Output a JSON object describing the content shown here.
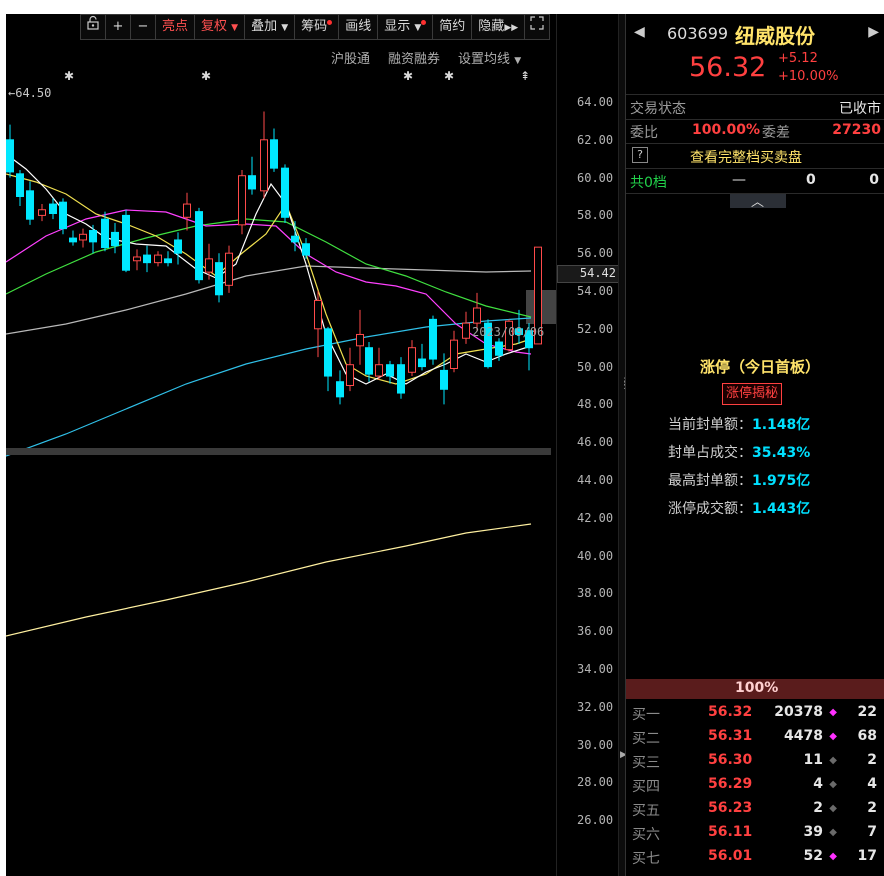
{
  "toolbar": {
    "buttons": [
      "+",
      "−",
      "亮点",
      "复权",
      "叠加",
      "筹码",
      "画线",
      "显示",
      "简约",
      "隐藏"
    ],
    "links": [
      "沪股通",
      "融资融券",
      "设置均线"
    ]
  },
  "chart": {
    "max_marker": "←64.50",
    "price_axis": [
      "64.00",
      "62.00",
      "60.00",
      "58.00",
      "56.00",
      "54.00",
      "52.00",
      "50.00",
      "48.00",
      "46.00",
      "44.00",
      "42.00",
      "40.00",
      "38.00",
      "36.00",
      "34.00",
      "32.00",
      "30.00",
      "28.00",
      "26.00"
    ],
    "current_axis_value": "54.42",
    "overlay_text": "2023/09/06",
    "colors": {
      "up": "#ff4a4a",
      "down": "#00e8ff",
      "ma5": "#ffffff",
      "ma10": "#f0e050",
      "ma20": "#ff40ff",
      "ma30": "#40e040",
      "ma60": "#b8b8b8",
      "ma120": "#30c0e8",
      "ma250": "#fff0a0"
    }
  },
  "stock": {
    "code": "603699",
    "name": "纽威股份",
    "price": "56.32",
    "change": "+5.12",
    "change_pct": "+10.00%"
  },
  "status": {
    "label": "交易状态",
    "value": "已收市",
    "ratio_label": "委比",
    "ratio_value": "100.00%",
    "diff_label": "委差",
    "diff_value": "27230",
    "help_icon": "?",
    "full_book_link": "查看完整档买卖盘",
    "levels_label": "共0档",
    "levels_dash": "—",
    "levels_v1": "0",
    "levels_v2": "0"
  },
  "limit_up": {
    "title": "涨停（今日首板）",
    "reveal_button": "涨停揭秘",
    "rows": [
      {
        "label": "当前封单额：",
        "value": "1.148亿"
      },
      {
        "label": "封单占成交：",
        "value": "35.43%"
      },
      {
        "label": "最高封单额：",
        "value": "1.975亿"
      },
      {
        "label": "涨停成交额：",
        "value": "1.443亿"
      }
    ]
  },
  "order_book": {
    "percent": "100%",
    "bids": [
      {
        "label": "买一",
        "price": "56.32",
        "volume": "20378",
        "dot": "magenta",
        "count": "22"
      },
      {
        "label": "买二",
        "price": "56.31",
        "volume": "4478",
        "dot": "magenta",
        "count": "68"
      },
      {
        "label": "买三",
        "price": "56.30",
        "volume": "11",
        "dot": "grey",
        "count": "2"
      },
      {
        "label": "买四",
        "price": "56.29",
        "volume": "4",
        "dot": "grey",
        "count": "4"
      },
      {
        "label": "买五",
        "price": "56.23",
        "volume": "2",
        "dot": "grey",
        "count": "2"
      },
      {
        "label": "买六",
        "price": "56.11",
        "volume": "39",
        "dot": "grey",
        "count": "7"
      },
      {
        "label": "买七",
        "price": "56.01",
        "volume": "52",
        "dot": "magenta",
        "count": "17"
      }
    ]
  }
}
